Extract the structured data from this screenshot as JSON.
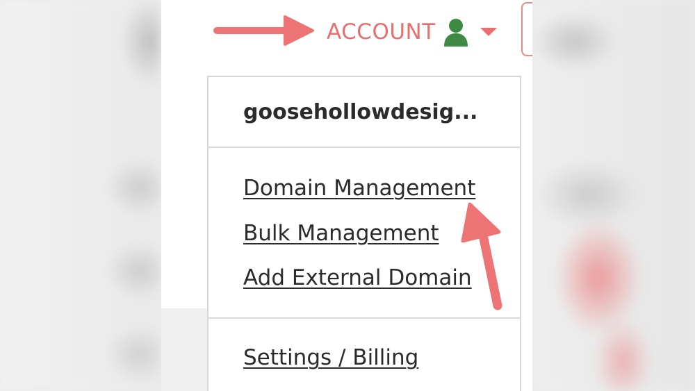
{
  "header": {
    "account_label": "ACCOUNT",
    "user_icon": "user-icon",
    "caret_icon": "caret-down-icon"
  },
  "menu": {
    "account_name": "goosehollowdesig...",
    "domain_links": [
      {
        "label": "Domain Management"
      },
      {
        "label": "Bulk Management"
      },
      {
        "label": "Add External Domain"
      }
    ],
    "settings_links": [
      {
        "label": "Settings / Billing"
      }
    ]
  },
  "colors": {
    "accent": "#e96e6e",
    "arrow": "#ec7474",
    "user_icon": "#3e8a45",
    "text": "#2b2b2b",
    "divider": "#dadada"
  }
}
